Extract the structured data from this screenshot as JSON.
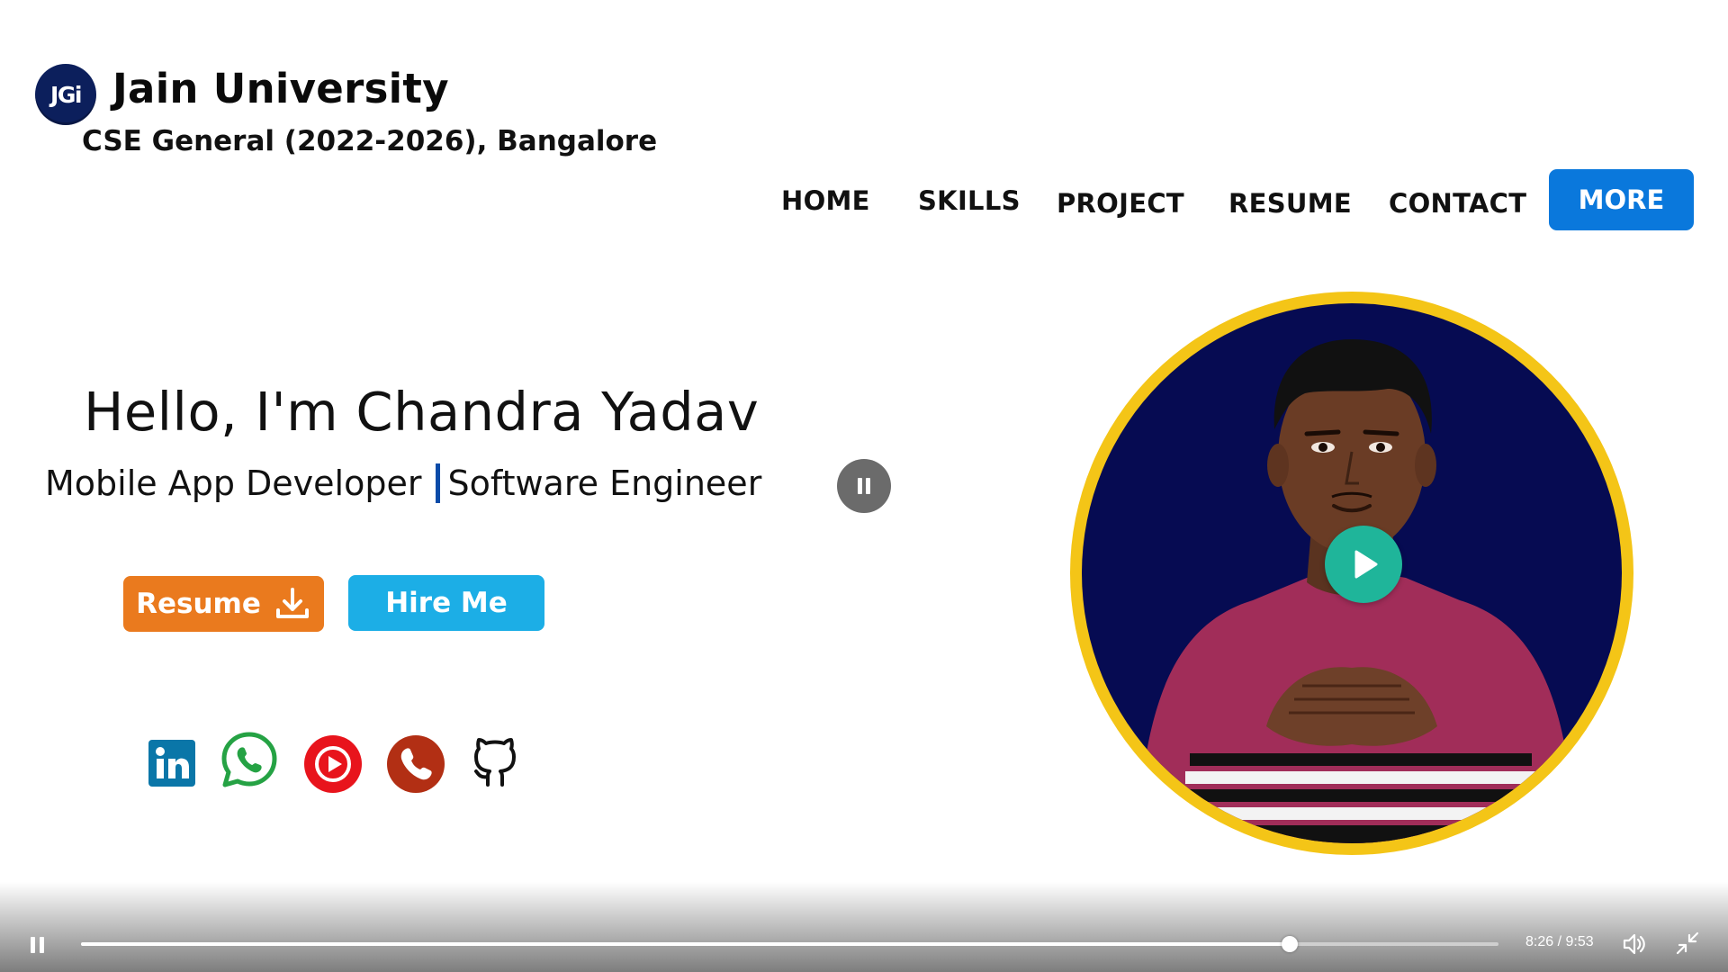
{
  "header": {
    "logo_text": "JGi",
    "university": "Jain University",
    "batch": "CSE General (2022-2026), Bangalore"
  },
  "nav": {
    "items": [
      {
        "label": "HOME"
      },
      {
        "label": "SKILLS"
      },
      {
        "label": "PROJECT"
      },
      {
        "label": "RESUME"
      },
      {
        "label": "CONTACT"
      }
    ],
    "more_label": "MORE"
  },
  "hero": {
    "greeting": "Hello, I'm Chandra Yadav",
    "role_primary": "Mobile App Developer",
    "role_secondary": "Software Engineer",
    "resume_label": "Resume",
    "hire_label": "Hire Me"
  },
  "social": [
    "linkedin-icon",
    "whatsapp-icon",
    "youtube-icon",
    "phone-icon",
    "github-icon"
  ],
  "colors": {
    "accent_blue": "#0a78dc",
    "resume_orange": "#ea7a1e",
    "hire_cyan": "#1caee6",
    "ring_yellow": "#f4c517",
    "photo_bg": "#060b52",
    "play_teal": "#1fb59a",
    "linkedin": "#0a76a8",
    "whatsapp": "#25a244",
    "youtube": "#e8141c",
    "phone": "#b22f14"
  },
  "video": {
    "current_time": "8:26",
    "separator": " / ",
    "duration": "9:53",
    "progress_fraction": 0.853
  }
}
